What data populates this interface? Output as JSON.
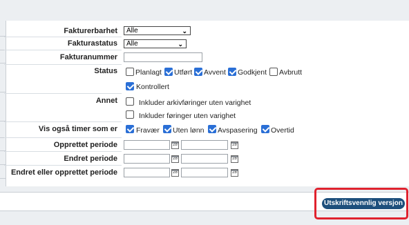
{
  "filters": {
    "fakturerbarhet": {
      "label": "Fakturerbarhet",
      "value": "Alle"
    },
    "fakturastatus": {
      "label": "Fakturastatus",
      "value": "Alle"
    },
    "fakturanummer": {
      "label": "Fakturanummer",
      "value": ""
    },
    "status": {
      "label": "Status",
      "options": [
        {
          "label": "Planlagt",
          "checked": false
        },
        {
          "label": "Utført",
          "checked": true
        },
        {
          "label": "Avvent",
          "checked": true
        },
        {
          "label": "Godkjent",
          "checked": true
        },
        {
          "label": "Avbrutt",
          "checked": false
        },
        {
          "label": "Kontrollert",
          "checked": true
        }
      ]
    },
    "annet": {
      "label": "Annet",
      "options": [
        {
          "label": "Inkluder arkivføringer uten varighet",
          "checked": false
        },
        {
          "label": "Inkluder føringer uten varighet",
          "checked": false
        }
      ]
    },
    "vis_timer": {
      "label": "Vis også timer som er",
      "options": [
        {
          "label": "Fravær",
          "checked": true
        },
        {
          "label": "Uten lønn",
          "checked": true
        },
        {
          "label": "Avspasering",
          "checked": true
        },
        {
          "label": "Overtid",
          "checked": true
        }
      ]
    },
    "opprettet_periode": {
      "label": "Opprettet periode",
      "from": "",
      "to": ""
    },
    "endret_periode": {
      "label": "Endret periode",
      "from": "",
      "to": ""
    },
    "endret_eller_opprettet": {
      "label": "Endret eller opprettet periode",
      "from": "",
      "to": ""
    }
  },
  "calendar_icon_text": "28",
  "print_button_label": "Utskriftsvennlig versjon",
  "colors": {
    "accent": "#2a6fd6",
    "button": "#1d4f7c",
    "highlight": "#e0222e"
  }
}
